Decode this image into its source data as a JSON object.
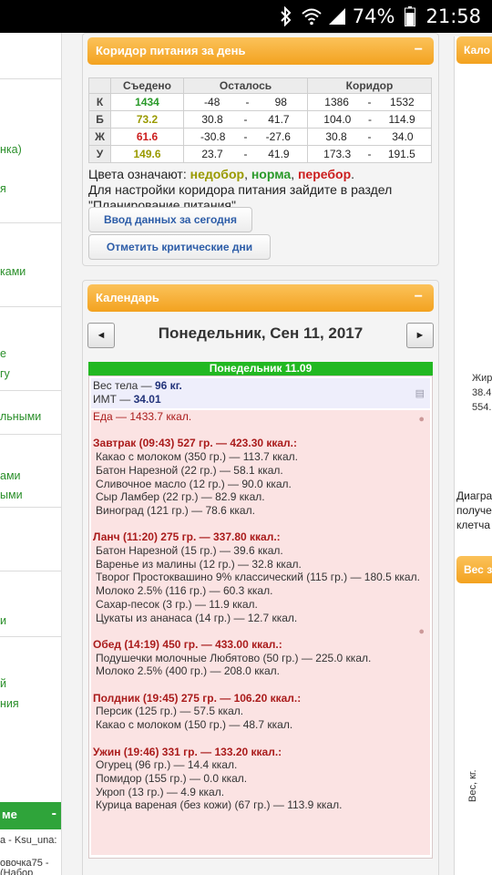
{
  "status_bar": {
    "battery": "74%",
    "time": "21:58"
  },
  "left_sidebar": {
    "fragments": [
      "нка)",
      "я",
      "ками",
      "е",
      "гу",
      "льными",
      "ами",
      "ыми",
      "и",
      "й",
      "ния"
    ],
    "section_title": "ме",
    "section_toggle": "-",
    "users": [
      "a - Ksu_una:",
      "овочка75 -",
      "(Набор"
    ]
  },
  "corridor": {
    "title": "Коридор питания за день",
    "toggle": "−",
    "columns": [
      "Съедено",
      "Осталось",
      "Коридор"
    ],
    "rows": [
      {
        "label": "К",
        "eaten": "1434",
        "left_min": "-48",
        "dash1": "-",
        "left_max": "98",
        "corr_min": "1386",
        "dash2": "-",
        "corr_max": "1532"
      },
      {
        "label": "Б",
        "eaten": "73.2",
        "left_min": "30.8",
        "dash1": "-",
        "left_max": "41.7",
        "corr_min": "104.0",
        "dash2": "-",
        "corr_max": "114.9"
      },
      {
        "label": "Ж",
        "eaten": "61.6",
        "left_min": "-30.8",
        "dash1": "-",
        "left_max": "-27.6",
        "corr_min": "30.8",
        "dash2": "-",
        "corr_max": "34.0"
      },
      {
        "label": "У",
        "eaten": "149.6",
        "left_min": "23.7",
        "dash1": "-",
        "left_max": "41.9",
        "corr_min": "173.3",
        "dash2": "-",
        "corr_max": "191.5"
      }
    ],
    "legend_prefix": "Цвета означают:",
    "legend_low": "недобор",
    "legend_norm": "норма",
    "legend_over": "перебор",
    "settings_note": "Для настройки коридора питания зайдите в раздел \"Планирование питания\".",
    "btn_today": "Ввод данных за сегодня",
    "btn_critical": "Отметить критические дни",
    "colors": {
      "low": "#9a9a00",
      "norm": "#2a9a2a",
      "over": "#cc1f1f"
    }
  },
  "calendar": {
    "title": "Календарь",
    "toggle": "−",
    "prev": "◄",
    "next": "►",
    "date_title": "Понедельник, Сен 11, 2017",
    "day_header": "Понедельник 11.09",
    "weight_label": "Вес тела — ",
    "weight_value": "96 кг.",
    "bmi_label": "ИМТ — ",
    "bmi_value": "34.01",
    "food_total": "Еда — 1433.7 ккал.",
    "meals": [
      {
        "title": "Завтрак (09:43) 527 гр. — 423.30 ккал.:",
        "items": [
          "Какао с молоком (350 гр.) — 113.7 ккал.",
          "Батон Нарезной (22 гр.) — 58.1 ккал.",
          "Сливочное масло (12 гр.) — 90.0 ккал.",
          "Сыр Ламбер (22 гр.) — 82.9 ккал.",
          "Виноград (121 гр.) — 78.6 ккал."
        ]
      },
      {
        "title": "Ланч (11:20) 275 гр. — 337.80 ккал.:",
        "items": [
          "Батон Нарезной (15 гр.) — 39.6 ккал.",
          "Варенье из малины (12 гр.) — 32.8 ккал.",
          "Творог Простоквашино 9% классический (115 гр.) — 180.5 ккал.",
          "Молоко 2.5% (116 гр.) — 60.3 ккал.",
          "Сахар-песок (3 гр.) — 11.9 ккал.",
          "Цукаты из ананаса (14 гр.) — 12.7 ккал."
        ]
      },
      {
        "title": "Обед (14:19) 450 гр. — 433.00 ккал.:",
        "items": [
          "Подушечки молочные Любятово (50 гр.) — 225.0 ккал.",
          "Молоко 2.5% (400 гр.) — 208.0 ккал."
        ]
      },
      {
        "title": "Полдник (19:45) 275 гр. — 106.20 ккал.:",
        "items": [
          "Персик (125 гр.) — 57.5 ккал.",
          "Какао с молоком (150 гр.) — 48.7 ккал."
        ]
      },
      {
        "title": "Ужин (19:46) 331 гр. — 133.20 ккал.:",
        "items": [
          "Огурец (96 гр.) — 14.4 ккал.",
          "Помидор (155 гр.) — 0.0 ккал.",
          "Укроп (13 гр.) — 4.9 ккал.",
          "Курица вареная (без кожи) (67 гр.) — 113.9 ккал."
        ]
      }
    ]
  },
  "right_sidebar": {
    "header1": "Кало",
    "stats": [
      "Жир",
      "38.4",
      "554."
    ],
    "diagram_text": [
      "Диагра",
      "получе",
      "клетча"
    ],
    "header2": "Вес з",
    "axis_label": "Вес, кг."
  }
}
